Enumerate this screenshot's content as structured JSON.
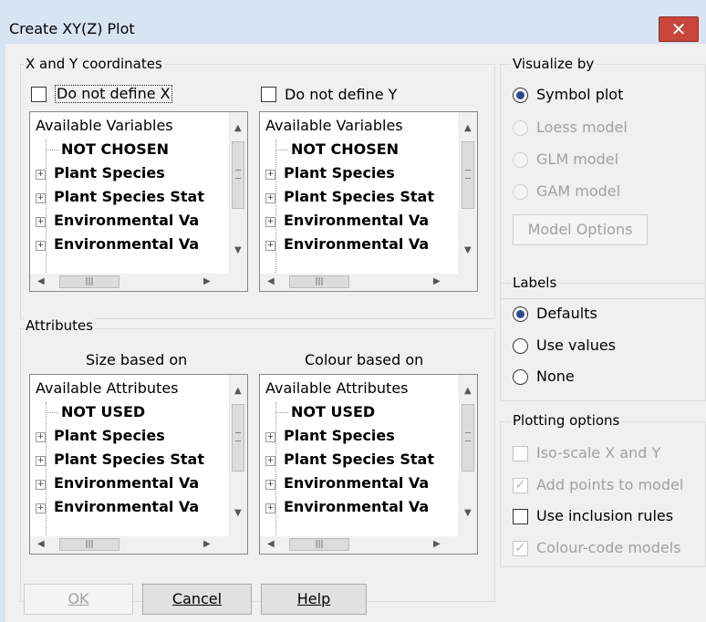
{
  "window": {
    "title": "Create XY(Z) Plot",
    "close_label": "✕"
  },
  "xy": {
    "group_label": "X and Y coordinates",
    "x_check_label": "Do not define X",
    "y_check_label": "Do not define Y",
    "tree_header": "Available Variables",
    "tree_items": [
      "NOT CHOSEN",
      "Plant Species",
      "Plant Species Stat",
      "Environmental Va",
      "Environmental Va"
    ]
  },
  "attributes": {
    "group_label": "Attributes",
    "size_label": "Size based on",
    "colour_label": "Colour based on",
    "tree_header": "Available Attributes",
    "tree_items": [
      "NOT USED",
      "Plant Species",
      "Plant Species Stat",
      "Environmental Va",
      "Environmental Va"
    ]
  },
  "visualize": {
    "group_label": "Visualize by",
    "options": [
      {
        "label": "Symbol plot",
        "selected": true,
        "enabled": true
      },
      {
        "label": "Loess model",
        "selected": false,
        "enabled": false
      },
      {
        "label": "GLM model",
        "selected": false,
        "enabled": false
      },
      {
        "label": "GAM model",
        "selected": false,
        "enabled": false
      }
    ],
    "model_options_label": "Model Options"
  },
  "labels": {
    "group_label": "Labels",
    "options": [
      {
        "label": "Defaults",
        "selected": true
      },
      {
        "label": "Use values",
        "selected": false
      },
      {
        "label": "None",
        "selected": false
      }
    ]
  },
  "plotting": {
    "group_label": "Plotting options",
    "options": [
      {
        "label": "Iso-scale X and Y",
        "checked": false,
        "enabled": false
      },
      {
        "label": "Add points to model",
        "checked": true,
        "enabled": false
      },
      {
        "label": "Use inclusion rules",
        "checked": false,
        "enabled": true
      },
      {
        "label": "Colour-code models",
        "checked": true,
        "enabled": false
      }
    ]
  },
  "buttons": {
    "ok": "OK",
    "cancel": "Cancel",
    "help": "Help"
  },
  "colors": {
    "accent": "#2c4a8c",
    "close": "#c8463b",
    "titlebar": "#d7e4f2"
  }
}
